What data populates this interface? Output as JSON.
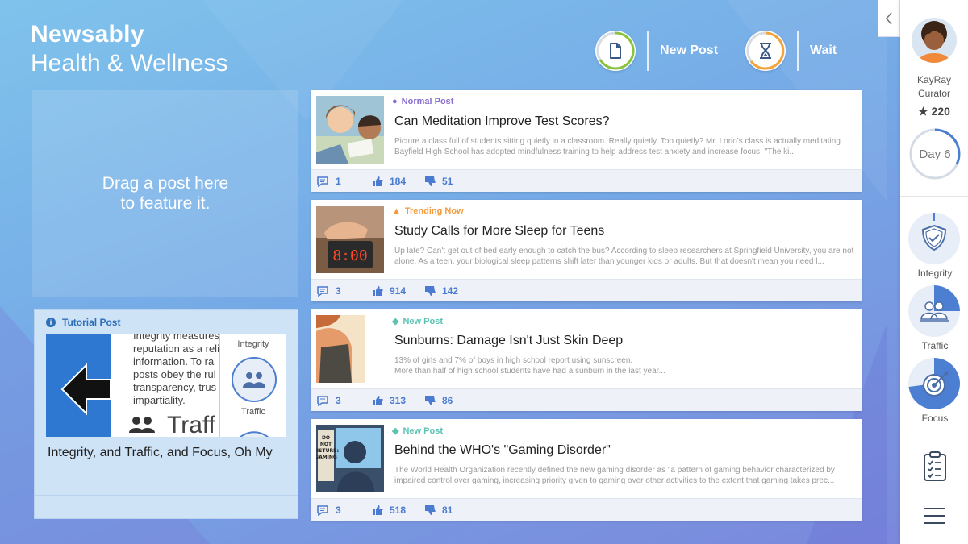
{
  "header": {
    "app_name": "Newsably",
    "section": "Health & Wellness",
    "actions": [
      {
        "label": "New Post",
        "icon": "document-icon"
      },
      {
        "label": "Wait",
        "icon": "hourglass-icon"
      }
    ]
  },
  "feature_zone": {
    "hint_line1": "Drag a post here",
    "hint_line2": "to feature it."
  },
  "tutorial": {
    "tag": "Tutorial Post",
    "excerpt": "Integrity measures\nreputation as a reli\ninformation. To ra\nposts obey the rul\ntransparency, trus\nimpartiality.",
    "traffic_word": "Traff",
    "side_labels": [
      "Integrity",
      "Traffic"
    ],
    "title": "Integrity, and Traffic, and Focus, Oh My"
  },
  "posts": [
    {
      "type": "Normal Post",
      "type_color": "#8a6fd1",
      "title": "Can Meditation Improve Test Scores?",
      "excerpt": "Picture a class full of students sitting quietly in a classroom. Really quietly. Too quietly? Mr. Lorio's class is actually meditating. Bayfield High School has adopted mindfulness training to help address test anxiety and increase focus. \"The ki...",
      "comments": "1",
      "likes": "184",
      "dislikes": "51"
    },
    {
      "type": "Trending Now",
      "type_color": "#f39a3a",
      "title": "Study Calls for More Sleep for Teens",
      "excerpt": "Up late? Can't get out of bed early enough to catch the bus? According to sleep researchers at Springfield University, you are not alone. As a teen, your biological sleep patterns shift later than younger kids or adults. But that doesn't mean you need l...",
      "comments": "3",
      "likes": "914",
      "dislikes": "142"
    },
    {
      "type": "New Post",
      "type_color": "#5cc3b3",
      "title": "Sunburns: Damage Isn't Just Skin Deep",
      "excerpt": "13% of girls and 7% of boys in high school report using sunscreen.\nMore than half of high school students have had a sunburn in the last year...",
      "comments": "3",
      "likes": "313",
      "dislikes": "86"
    },
    {
      "type": "New Post",
      "type_color": "#5cc3b3",
      "title": "Behind the WHO's \"Gaming Disorder\"",
      "excerpt": "The World Health Organization recently defined the new gaming disorder as \"a pattern of gaming behavior characterized by impaired control over gaming, increasing priority given to gaming over other activities to the extent that gaming takes prec...",
      "comments": "3",
      "likes": "518",
      "dislikes": "81"
    }
  ],
  "thumb_texts": {
    "clock": "8:00",
    "sign": "DO\nNOT\nDISTURB:\nGAMING"
  },
  "sidebar": {
    "user_name": "KayRay",
    "user_role": "Curator",
    "score": "220",
    "day": "Day 6",
    "metrics": [
      {
        "label": "Integrity",
        "icon": "shield-icon"
      },
      {
        "label": "Traffic",
        "icon": "people-icon"
      },
      {
        "label": "Focus",
        "icon": "target-icon"
      }
    ]
  }
}
